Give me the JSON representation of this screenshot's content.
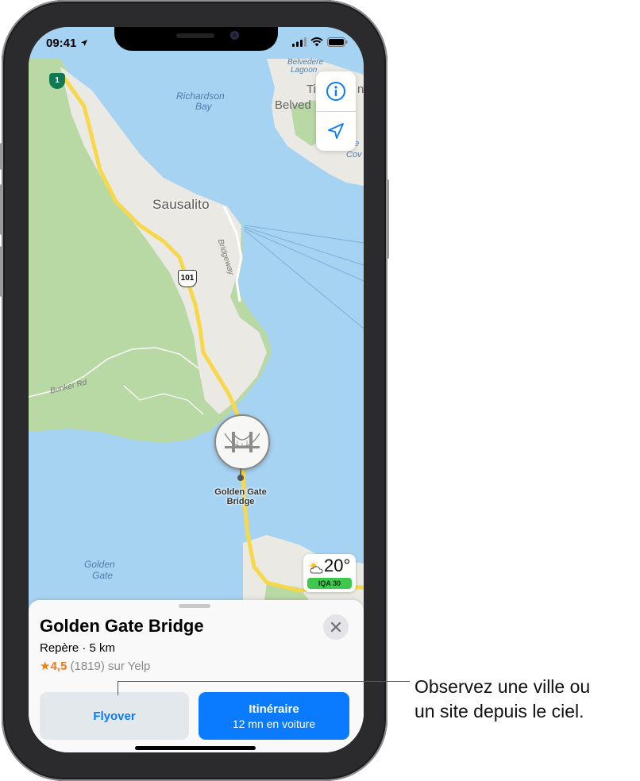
{
  "status_bar": {
    "time": "09:41"
  },
  "map": {
    "water_labels": [
      "Richardson",
      "Bay",
      "Golden",
      "Gate"
    ],
    "city_label": "Sausalito",
    "partial_labels": {
      "belvedere": "Belved",
      "tiburon": "Ti",
      "tiburon_tail": "n",
      "lagoon_top": "Belvedere",
      "lagoon": "Lagoon",
      "cove1": "e",
      "cove2": "Cov"
    },
    "road_labels": {
      "bridgeway": "Bridgeway",
      "bunker": "Bunker Rd"
    },
    "route_shields": {
      "hwy1": "1",
      "us101": "101"
    },
    "landmark_label_line1": "Golden Gate",
    "landmark_label_line2": "Bridge",
    "controls": {
      "info_icon": "info-icon",
      "location_icon": "location-arrow-icon"
    }
  },
  "weather": {
    "temperature": "20°",
    "aqi": "IQA 30",
    "icon": "partly-cloudy-icon",
    "aqi_color": "#3fc84e"
  },
  "place_card": {
    "title": "Golden Gate Bridge",
    "subtitle": "Repère · 5 km",
    "rating": "★4,5",
    "rating_detail": "(1819) sur Yelp",
    "flyover_label": "Flyover",
    "route_label": "Itinéraire",
    "route_detail": "12 mn en voiture"
  },
  "callout": {
    "line1": "Observez une ville ou",
    "line2": "un site depuis le ciel."
  },
  "colors": {
    "accent": "#0a7aff",
    "water": "#a7d3f2",
    "land_green": "#b8d8a4",
    "urban": "#eae9e3",
    "highway": "#f7d84a",
    "rating_orange": "#f37a13"
  }
}
